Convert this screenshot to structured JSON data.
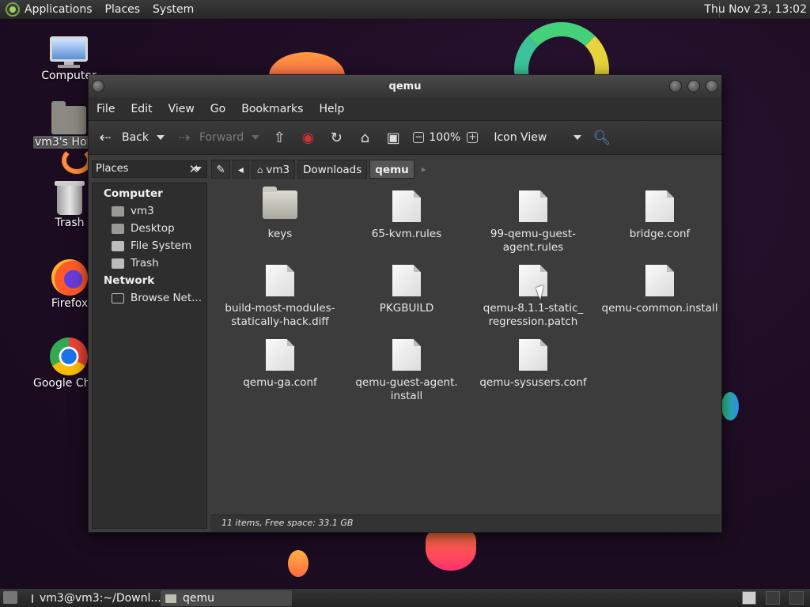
{
  "top_panel": {
    "menus": [
      "Applications",
      "Places",
      "System"
    ],
    "clock": "Thu Nov 23, 13:02"
  },
  "desktop": {
    "icons": [
      {
        "label": "Computer",
        "icon": "computer-icon"
      },
      {
        "label": "vm3's Home",
        "icon": "home-folder-icon"
      },
      {
        "label": "Trash",
        "icon": "trash-icon"
      },
      {
        "label": "Firefox",
        "icon": "firefox-icon"
      },
      {
        "label": "Google Chrome",
        "icon": "chrome-icon"
      }
    ]
  },
  "window": {
    "title": "qemu",
    "menu": [
      "File",
      "Edit",
      "View",
      "Go",
      "Bookmarks",
      "Help"
    ],
    "toolbar": {
      "back": "Back",
      "forward": "Forward",
      "zoom": "100%",
      "view_mode": "Icon View"
    },
    "places_label": "Places",
    "breadcrumbs": [
      "vm3",
      "Downloads",
      "qemu"
    ],
    "sidebar": {
      "sections": [
        {
          "heading": "Computer",
          "items": [
            "vm3",
            "Desktop",
            "File System",
            "Trash"
          ]
        },
        {
          "heading": "Network",
          "items": [
            "Browse Net..."
          ]
        }
      ]
    },
    "files": [
      {
        "name": "keys",
        "type": "folder"
      },
      {
        "name": "65-kvm.rules",
        "type": "file"
      },
      {
        "name": "99-qemu-guest-agent.rules",
        "type": "file"
      },
      {
        "name": "bridge.conf",
        "type": "file"
      },
      {
        "name": "build-most-modules-statically-hack.diff",
        "type": "file"
      },
      {
        "name": "PKGBUILD",
        "type": "file"
      },
      {
        "name": "qemu-8.1.1-static_regression.patch",
        "type": "file"
      },
      {
        "name": "qemu-common.install",
        "type": "file"
      },
      {
        "name": "qemu-ga.conf",
        "type": "file"
      },
      {
        "name": "qemu-guest-agent.install",
        "type": "file"
      },
      {
        "name": "qemu-sysusers.conf",
        "type": "file"
      }
    ],
    "file_labels": [
      "keys",
      "65-kvm.rules",
      "99-qemu-guest-\nagent.rules",
      "bridge.conf",
      "build-most-modules-\nstatically-hack.diff",
      "PKGBUILD",
      "qemu-8.1.1-static_\nregression.patch",
      "qemu-common.install",
      "qemu-ga.conf",
      "qemu-guest-agent.\ninstall",
      "qemu-sysusers.conf"
    ],
    "status": "11 items, Free space: 33.1 GB"
  },
  "taskbar": {
    "tasks": [
      {
        "label": "vm3@vm3:~/Downl...",
        "active": false
      },
      {
        "label": "qemu",
        "active": true
      }
    ]
  }
}
